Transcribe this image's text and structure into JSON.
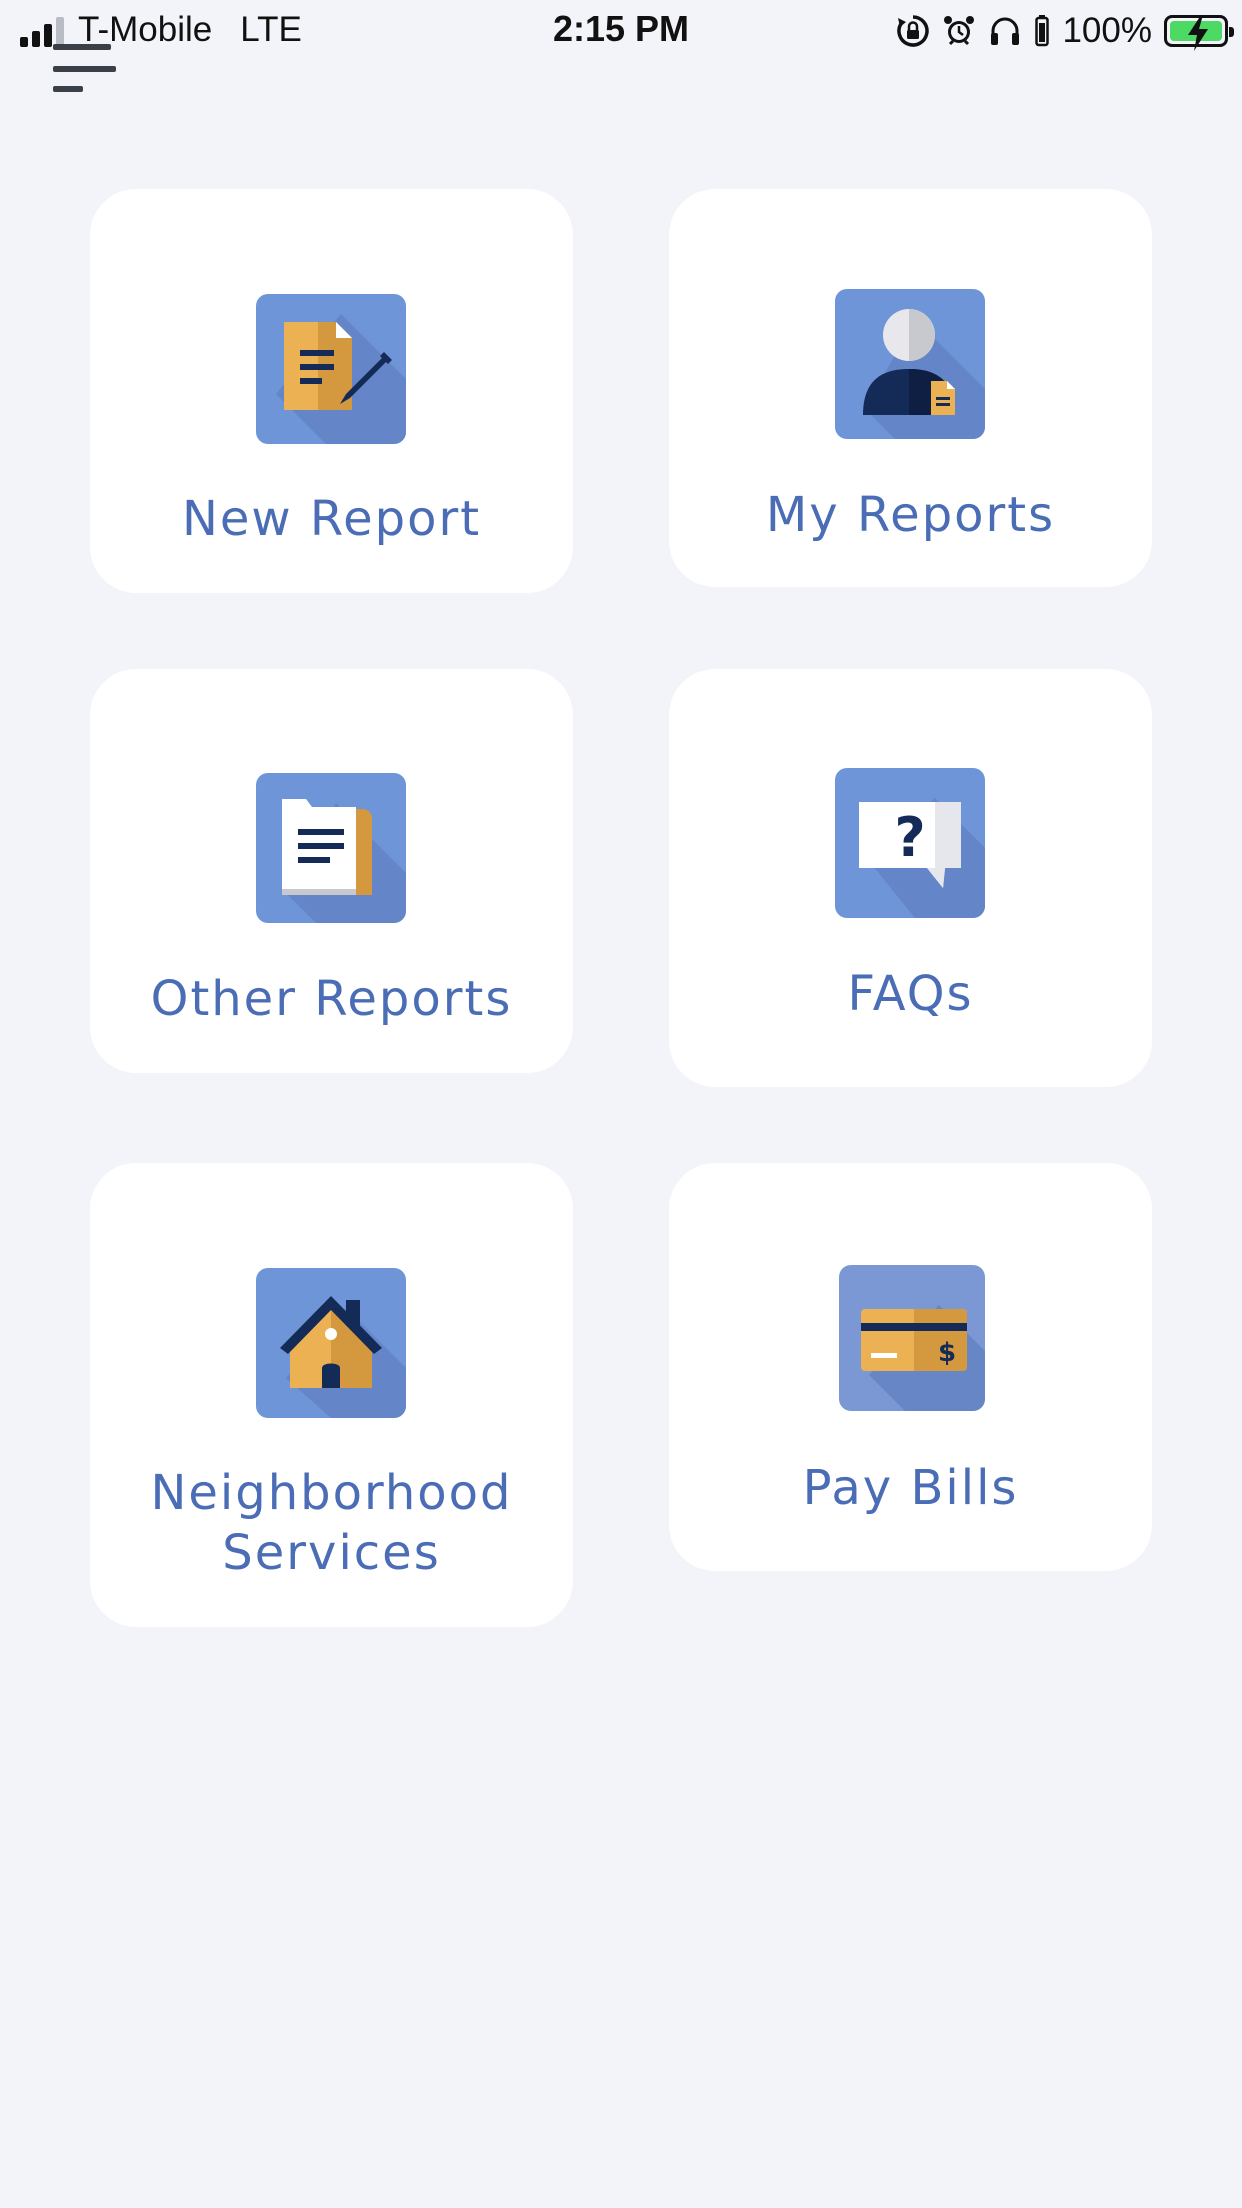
{
  "status_bar": {
    "carrier": "T-Mobile",
    "network": "LTE",
    "time": "2:15 PM",
    "battery_percent": "100%",
    "icons": [
      "signal-icon",
      "orientation-lock-icon",
      "alarm-icon",
      "headphones-icon",
      "battery-icon"
    ]
  },
  "menu": {
    "icon": "hamburger-menu-icon"
  },
  "tiles": [
    {
      "label": "New Report",
      "icon": "new-report-icon"
    },
    {
      "label": "My Reports",
      "icon": "my-reports-icon"
    },
    {
      "label": "Other Reports",
      "icon": "other-reports-icon"
    },
    {
      "label": "FAQs",
      "icon": "faq-icon"
    },
    {
      "label": "Neighborhood Services",
      "icon": "house-icon"
    },
    {
      "label": "Pay Bills",
      "icon": "credit-card-icon"
    }
  ],
  "colors": {
    "background": "#f2f4f9",
    "tile": "#ffffff",
    "label": "#4a6db6",
    "icon_background": "#6e95d7",
    "icon_accent": "#ecb152",
    "icon_dark": "#142a57"
  }
}
